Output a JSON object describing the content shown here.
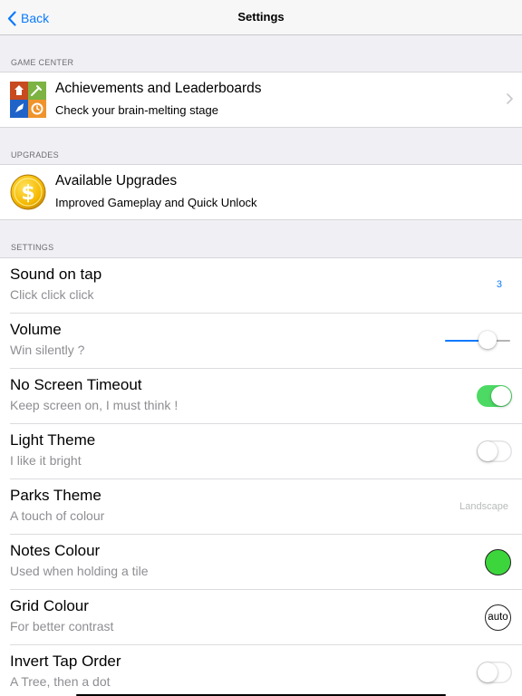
{
  "nav": {
    "back_label": "Back",
    "title": "Settings"
  },
  "game_center": {
    "header": "GAME CENTER",
    "title": "Achievements and Leaderboards",
    "subtitle": "Check your brain-melting stage",
    "icon": "game-center-icon"
  },
  "upgrades": {
    "header": "UPGRADES",
    "title": "Available Upgrades",
    "subtitle": "Improved Gameplay and Quick Unlock",
    "icon": "dollar-coin-icon"
  },
  "settings": {
    "header": "SETTINGS",
    "items": [
      {
        "title": "Sound on tap",
        "subtitle": "Click click click",
        "value": "3"
      },
      {
        "title": "Volume",
        "subtitle": "Win silently ?",
        "level": 0.65
      },
      {
        "title": "No Screen Timeout",
        "subtitle": "Keep screen on, I must think !",
        "on": true
      },
      {
        "title": "Light Theme",
        "subtitle": "I like it bright",
        "on": false
      },
      {
        "title": "Parks Theme",
        "subtitle": "A touch of colour",
        "value": "Landscape"
      },
      {
        "title": "Notes Colour",
        "subtitle": "Used when holding a tile",
        "color": "#3cd63c"
      },
      {
        "title": "Grid Colour",
        "subtitle": "For better contrast",
        "value": "auto"
      },
      {
        "title": "Invert Tap Order",
        "subtitle": "A Tree, then a dot",
        "on": false
      }
    ]
  },
  "colors": {
    "accent": "#0a7aff",
    "toggle_on": "#4cd964",
    "background": "#efeff4"
  }
}
